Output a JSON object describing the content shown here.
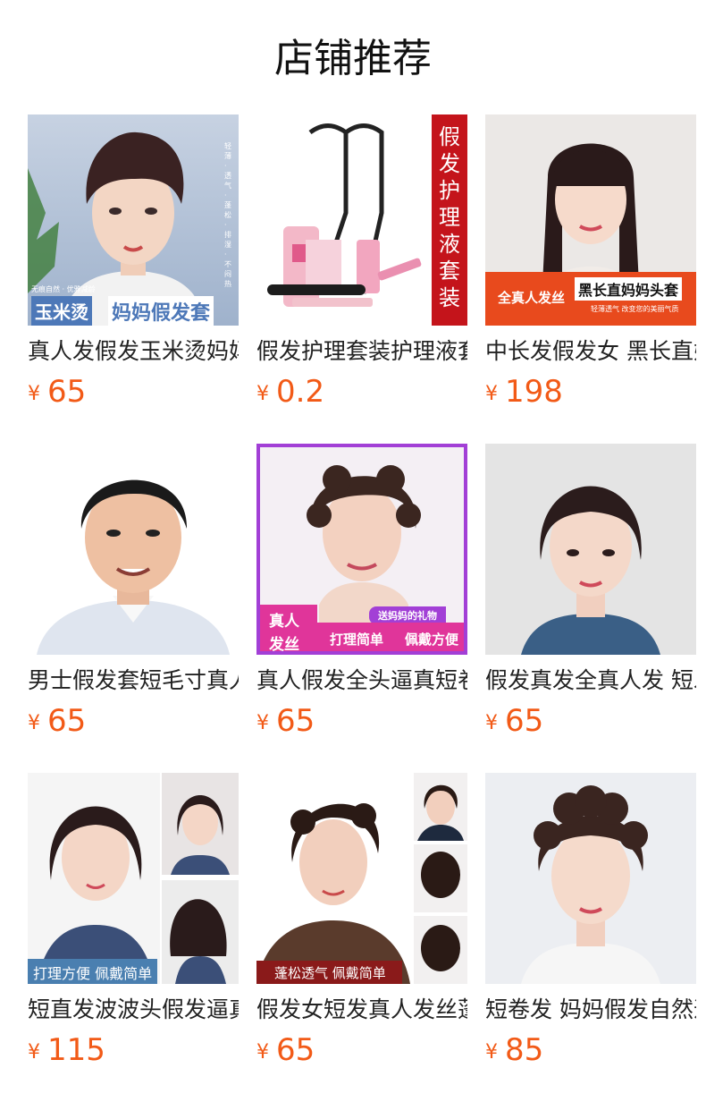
{
  "header": {
    "title": "店铺推荐"
  },
  "products": [
    {
      "name": "真人发假发玉米烫妈妈假发套",
      "currency": "¥",
      "price": "65",
      "image": {
        "icon": "curly-short-wig-photo",
        "badges": [
          "玉米烫",
          "妈妈假发套",
          "无痕自然 · 优雅减龄",
          "轻薄 · 透气 · 蓬松 · 排湿 · 不闷热"
        ],
        "bg": "#b9c6d8"
      }
    },
    {
      "name": "假发护理套装护理液套装",
      "currency": "¥",
      "price": "0.2",
      "image": {
        "icon": "wig-care-kit-photo",
        "badges": [
          "假",
          "发",
          "护",
          "理",
          "液",
          "套",
          "装"
        ],
        "bg": "#ffffff"
      }
    },
    {
      "name": "中长发假发女 黑长直妈妈头套",
      "currency": "¥",
      "price": "198",
      "image": {
        "icon": "long-straight-wig-photo",
        "badges": [
          "全真人发丝",
          "黑长直妈妈头套",
          "轻薄透气  改变您的美丽气质"
        ],
        "bg": "#e9e6e4"
      }
    },
    {
      "name": "男士假发套短毛寸真人发",
      "currency": "¥",
      "price": "65",
      "image": {
        "icon": "mens-short-wig-photo",
        "badges": [],
        "bg": "#ffffff"
      }
    },
    {
      "name": "真人假发全头逼真短卷发",
      "currency": "¥",
      "price": "65",
      "image": {
        "icon": "curly-wig-gift-photo",
        "badges": [
          "真人",
          "发丝",
          "送妈妈的礼物",
          "打理简单",
          "佩戴方便"
        ],
        "bg": "#f3eef4"
      }
    },
    {
      "name": "假发真发全真人发 短发女",
      "currency": "¥",
      "price": "65",
      "image": {
        "icon": "short-bob-wig-photo",
        "badges": [],
        "bg": "#e6e6e6"
      }
    },
    {
      "name": "短直发波波头假发逼真自然",
      "currency": "¥",
      "price": "115",
      "image": {
        "icon": "bob-wig-photo",
        "badges": [
          "打理方便 佩戴简单"
        ],
        "bg": "#ffffff"
      }
    },
    {
      "name": "假发女短发真人发丝蓬松",
      "currency": "¥",
      "price": "65",
      "image": {
        "icon": "fluffy-short-wig-photo",
        "badges": [
          "蓬松透气 佩戴简单"
        ],
        "bg": "#ffffff"
      }
    },
    {
      "name": "短卷发 妈妈假发自然逼真",
      "currency": "¥",
      "price": "85",
      "image": {
        "icon": "short-curly-wig-photo",
        "badges": [],
        "bg": "#eceef2"
      }
    }
  ],
  "colors": {
    "price": "#f25a17",
    "title": "#111111",
    "name": "#222222"
  }
}
